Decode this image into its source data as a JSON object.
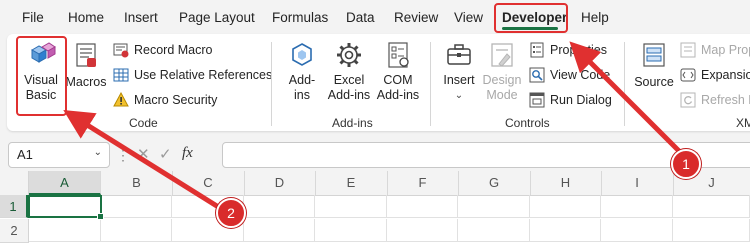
{
  "ribbon_tabs": [
    "File",
    "Home",
    "Insert",
    "Page Layout",
    "Formulas",
    "Data",
    "Review",
    "View",
    "Developer",
    "Help"
  ],
  "active_tab": "Developer",
  "groups": {
    "code": {
      "label": "Code",
      "visual_basic": [
        "Visual",
        "Basic"
      ],
      "macros": "Macros",
      "record_macro": "Record Macro",
      "use_relative": "Use Relative References",
      "macro_security": "Macro Security"
    },
    "addins": {
      "label": "Add-ins",
      "addins": [
        "Add-",
        "ins"
      ],
      "excel_addins": [
        "Excel",
        "Add-ins"
      ],
      "com_addins": [
        "COM",
        "Add-ins"
      ]
    },
    "controls": {
      "label": "Controls",
      "insert": "Insert",
      "design_mode": [
        "Design",
        "Mode"
      ],
      "properties": "Properties",
      "view_code": "View Code",
      "run_dialog": "Run Dialog"
    },
    "xml": {
      "label": "XM",
      "source": "Source",
      "map_properties": "Map Prop",
      "expansion": "Expansion",
      "refresh": "Refresh D"
    }
  },
  "formula_bar": {
    "name_box": "A1",
    "fx_label": "fx",
    "formula": ""
  },
  "columns": [
    "A",
    "B",
    "C",
    "D",
    "E",
    "F",
    "G",
    "H",
    "I",
    "J"
  ],
  "rows": [
    "1",
    "2"
  ],
  "callouts": [
    "1",
    "2"
  ],
  "colors": {
    "accent": "#1a7343",
    "highlight": "#e03030",
    "callout": "#d92b2b"
  }
}
